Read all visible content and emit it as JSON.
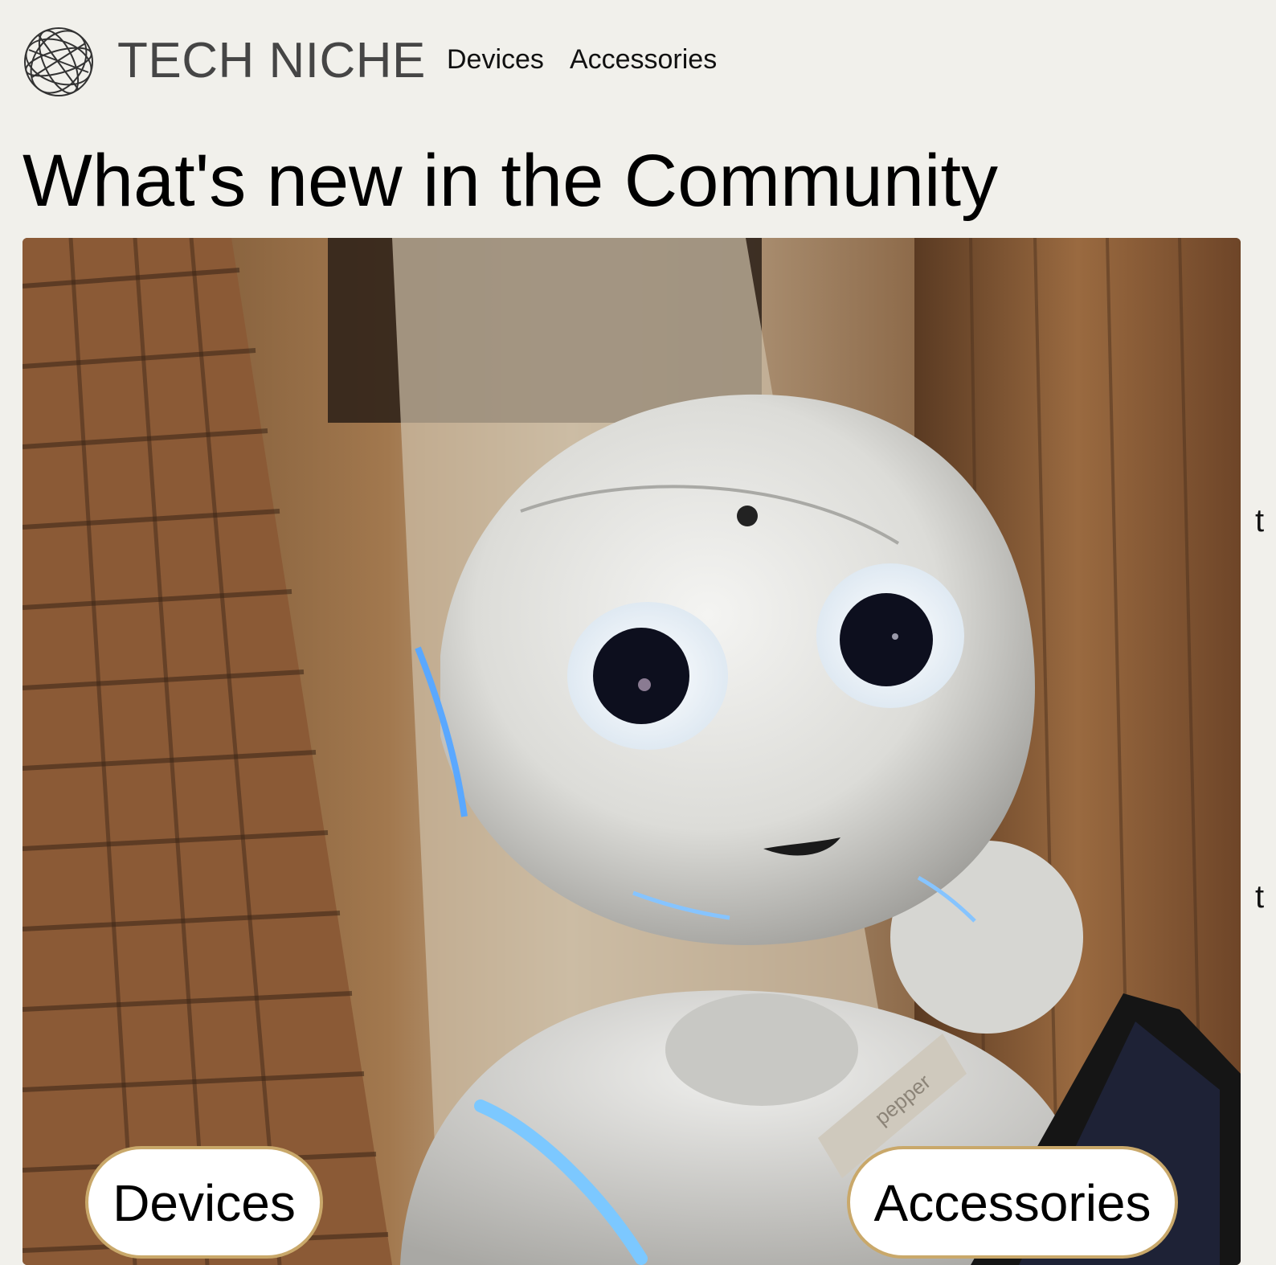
{
  "header": {
    "brand": "TECH NICHE",
    "logo_icon": "globe-wireframe-icon",
    "nav": [
      {
        "label": "Devices"
      },
      {
        "label": "Accessories"
      }
    ]
  },
  "main": {
    "title": "What's new in the Community",
    "hero": {
      "subject": "robot-photo",
      "label_plate": "pepper"
    },
    "categories": [
      {
        "label": "Devices"
      },
      {
        "label": "Accessories"
      }
    ],
    "edge_marks": [
      "t",
      "t"
    ]
  },
  "colors": {
    "background": "#f1f0eb",
    "brand_text": "#454545",
    "pill_border": "#c9a86a",
    "pill_fill": "#ffffff"
  }
}
